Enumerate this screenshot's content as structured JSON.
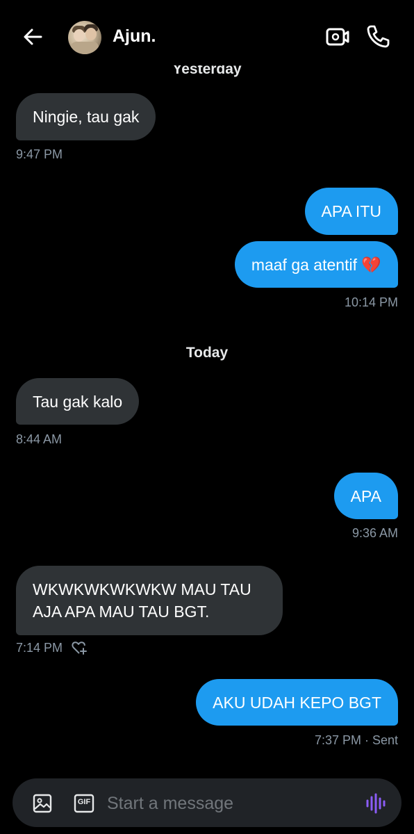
{
  "header": {
    "contact_name": "Ajun.",
    "back_icon": "arrow-left-icon",
    "video_icon": "video-call-icon",
    "call_icon": "phone-icon"
  },
  "days": {
    "yesterday": "Yesterday",
    "today": "Today"
  },
  "messages": [
    {
      "side": "received",
      "text": "Ningie, tau gak",
      "time": "9:47 PM"
    },
    {
      "side": "sent",
      "text": "APA ITU"
    },
    {
      "side": "sent",
      "text": "maaf ga atentif 💔",
      "time": "10:14 PM"
    },
    {
      "side": "received",
      "text": "Tau gak kalo",
      "time": "8:44 AM"
    },
    {
      "side": "sent",
      "text": "APA",
      "time": "9:36 AM"
    },
    {
      "side": "received",
      "line1": "WKWKWKWKWKW MAU TAU",
      "line2": "AJA APA MAU TAU BGT.",
      "time": "7:14 PM",
      "reaction_icon": "add-reaction-heart-icon"
    },
    {
      "side": "sent",
      "text": "AKU UDAH KEPO BGT",
      "time": "7:37 PM · Sent"
    }
  ],
  "composer": {
    "placeholder": "Start a message",
    "value": "",
    "image_icon": "image-icon",
    "gif_label": "GIF",
    "voice_icon": "voice-waveform-icon"
  },
  "colors": {
    "background": "#000000",
    "received_bubble": "#2f3336",
    "sent_bubble": "#1d9bf0",
    "timestamp": "#8b98a5",
    "voice_accent": "#8b5cf6"
  }
}
